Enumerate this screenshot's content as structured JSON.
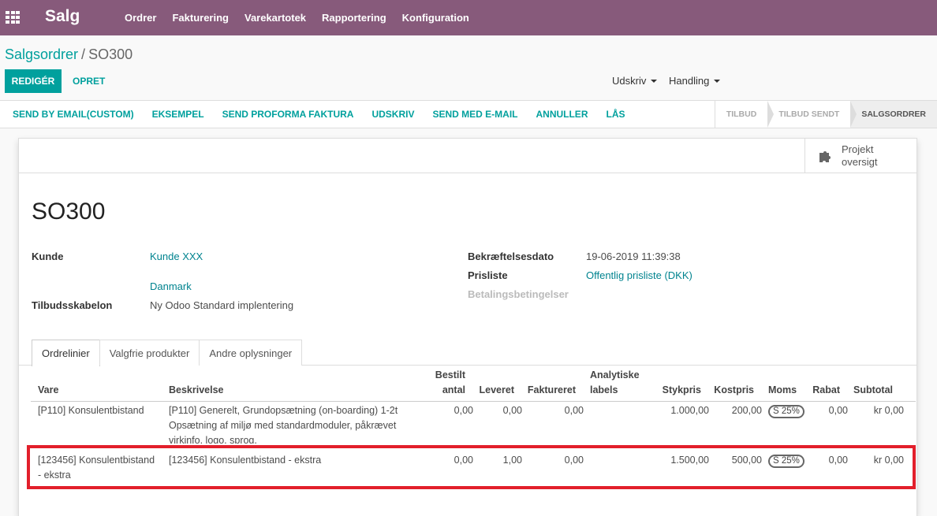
{
  "nav": {
    "brand": "Salg",
    "menu": [
      "Ordrer",
      "Fakturering",
      "Varekartotek",
      "Rapportering",
      "Konfiguration"
    ]
  },
  "breadcrumb": {
    "parent": "Salgsordrer",
    "separator": "/",
    "current": "SO300"
  },
  "actions": {
    "edit": "REDIGÉR",
    "create": "OPRET",
    "print": "Udskriv",
    "action": "Handling"
  },
  "statusbar": {
    "buttons": [
      "SEND BY EMAIL(CUSTOM)",
      "EKSEMPEL",
      "SEND PROFORMA FAKTURA",
      "UDSKRIV",
      "SEND MED E-MAIL",
      "ANNULLER",
      "LÅS"
    ],
    "stages": [
      "TILBUD",
      "TILBUD SENDT",
      "SALGSORDRER"
    ],
    "active_stage": "SALGSORDRER"
  },
  "stat_button": {
    "label_line1": "Projekt",
    "label_line2": "oversigt"
  },
  "record": {
    "name": "SO300",
    "customer_label": "Kunde",
    "customer_value": "Kunde XXX",
    "customer_country": "Danmark",
    "template_label": "Tilbudsskabelon",
    "template_value": "Ny Odoo Standard implentering",
    "confirm_label": "Bekræftelsesdato",
    "confirm_value": "19-06-2019 11:39:38",
    "pricelist_label": "Prisliste",
    "pricelist_value": "Offentlig prisliste (DKK)",
    "payment_label": "Betalingsbetingelser"
  },
  "tabs": [
    "Ordrelinier",
    "Valgfrie produkter",
    "Andre oplysninger"
  ],
  "table": {
    "headers": {
      "product": "Vare",
      "description": "Beskrivelse",
      "ordered_1": "Bestilt",
      "ordered_2": "antal",
      "delivered": "Leveret",
      "invoiced": "Faktureret",
      "analytic_1": "Analytiske",
      "analytic_2": "labels",
      "unit_price": "Stykpris",
      "cost": "Kostpris",
      "tax": "Moms",
      "discount": "Rabat",
      "subtotal": "Subtotal"
    },
    "rows": [
      {
        "product": "[P110] Konsulentbistand",
        "description_1": "[P110] Generelt, Grundopsætning (on-boarding) 1-2t",
        "description_2": "Opsætning af miljø med standardmoduler, påkrævet",
        "description_3": "virkinfo, logo, sprog.",
        "ordered": "0,00",
        "delivered": "0,00",
        "invoiced": "0,00",
        "unit_price": "1.000,00",
        "cost": "200,00",
        "tax": "S 25%",
        "discount": "0,00",
        "subtotal": "kr 0,00"
      },
      {
        "product_1": "[123456] Konsulentbistand",
        "product_2": "- ekstra",
        "description_1": "[123456] Konsulentbistand - ekstra",
        "ordered": "0,00",
        "delivered": "1,00",
        "invoiced": "0,00",
        "unit_price": "1.500,00",
        "cost": "500,00",
        "tax": "S 25%",
        "discount": "0,00",
        "subtotal": "kr 0,00"
      }
    ]
  }
}
